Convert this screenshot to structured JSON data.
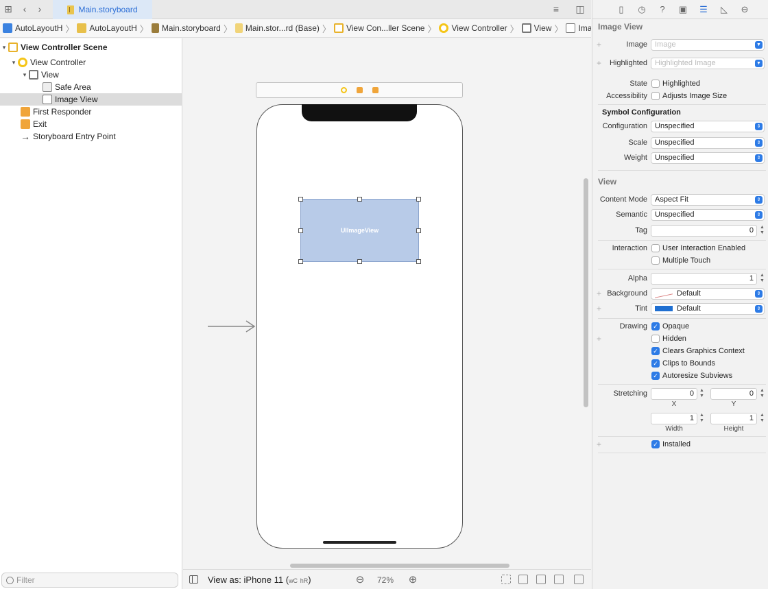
{
  "tabbar": {
    "active_tab": "Main.storyboard",
    "icons": [
      "grid-icon",
      "back-chevron-icon",
      "forward-chevron-icon",
      "lines-icon",
      "split-editor-icon"
    ]
  },
  "jumpbar": {
    "crumbs": [
      "AutoLayoutH",
      "AutoLayoutH",
      "Main.storyboard",
      "Main.stor...rd (Base)",
      "View Con...ller Scene",
      "View Controller",
      "View",
      "Image View"
    ]
  },
  "navigator": {
    "items": [
      {
        "label": "View Controller Scene"
      },
      {
        "label": "View Controller"
      },
      {
        "label": "View"
      },
      {
        "label": "Safe Area"
      },
      {
        "label": "Image View"
      },
      {
        "label": "First Responder"
      },
      {
        "label": "Exit"
      },
      {
        "label": "Storyboard Entry Point"
      }
    ],
    "filter_placeholder": "Filter"
  },
  "canvas": {
    "image_view_label": "UIImageView"
  },
  "bottombar": {
    "view_as_prefix": "View as: iPhone 11",
    "size_class_w": "wC",
    "size_class_h": "hR",
    "close_paren": ")",
    "open_paren": "(",
    "zoom": "72%",
    "zoom_out": "⊖",
    "zoom_in": "⊕"
  },
  "inspector": {
    "image_view_title": "Image View",
    "image_label": "Image",
    "image_placeholder": "Image",
    "highlighted_label": "Highlighted",
    "highlighted_placeholder": "Highlighted Image",
    "state_label": "State",
    "state_option": "Highlighted",
    "accessibility_label": "Accessibility",
    "accessibility_option": "Adjusts Image Size",
    "symbol_config_title": "Symbol Configuration",
    "configuration_label": "Configuration",
    "configuration_value": "Unspecified",
    "scale_label": "Scale",
    "scale_value": "Unspecified",
    "weight_label": "Weight",
    "weight_value": "Unspecified",
    "view_title": "View",
    "content_mode_label": "Content Mode",
    "content_mode_value": "Aspect Fit",
    "semantic_label": "Semantic",
    "semantic_value": "Unspecified",
    "tag_label": "Tag",
    "tag_value": "0",
    "interaction_label": "Interaction",
    "user_interaction_label": "User Interaction Enabled",
    "multiple_touch_label": "Multiple Touch",
    "alpha_label": "Alpha",
    "alpha_value": "1",
    "background_label": "Background",
    "background_value": "Default",
    "tint_label": "Tint",
    "tint_value": "Default",
    "drawing_label": "Drawing",
    "opaque_label": "Opaque",
    "hidden_label": "Hidden",
    "clears_label": "Clears Graphics Context",
    "clips_label": "Clips to Bounds",
    "autoresize_label": "Autoresize Subviews",
    "stretching_label": "Stretching",
    "stretch_x_value": "0",
    "stretch_y_value": "0",
    "stretch_x_caption": "X",
    "stretch_y_caption": "Y",
    "stretch_w_value": "1",
    "stretch_h_value": "1",
    "stretch_w_caption": "Width",
    "stretch_h_caption": "Height",
    "installed_label": "Installed",
    "checkboxes": {
      "state_highlighted": false,
      "adjusts_image_size": false,
      "user_interaction_enabled": false,
      "multiple_touch": false,
      "opaque": true,
      "hidden": false,
      "clears_graphics_context": true,
      "clips_to_bounds": true,
      "autoresize_subviews": true,
      "installed": true
    }
  },
  "colors": {
    "accent": "#2d7be6",
    "tab_text": "#2d6fd6",
    "image_view_fill": "#b8cbe8",
    "tint": "#1f6fd1"
  }
}
